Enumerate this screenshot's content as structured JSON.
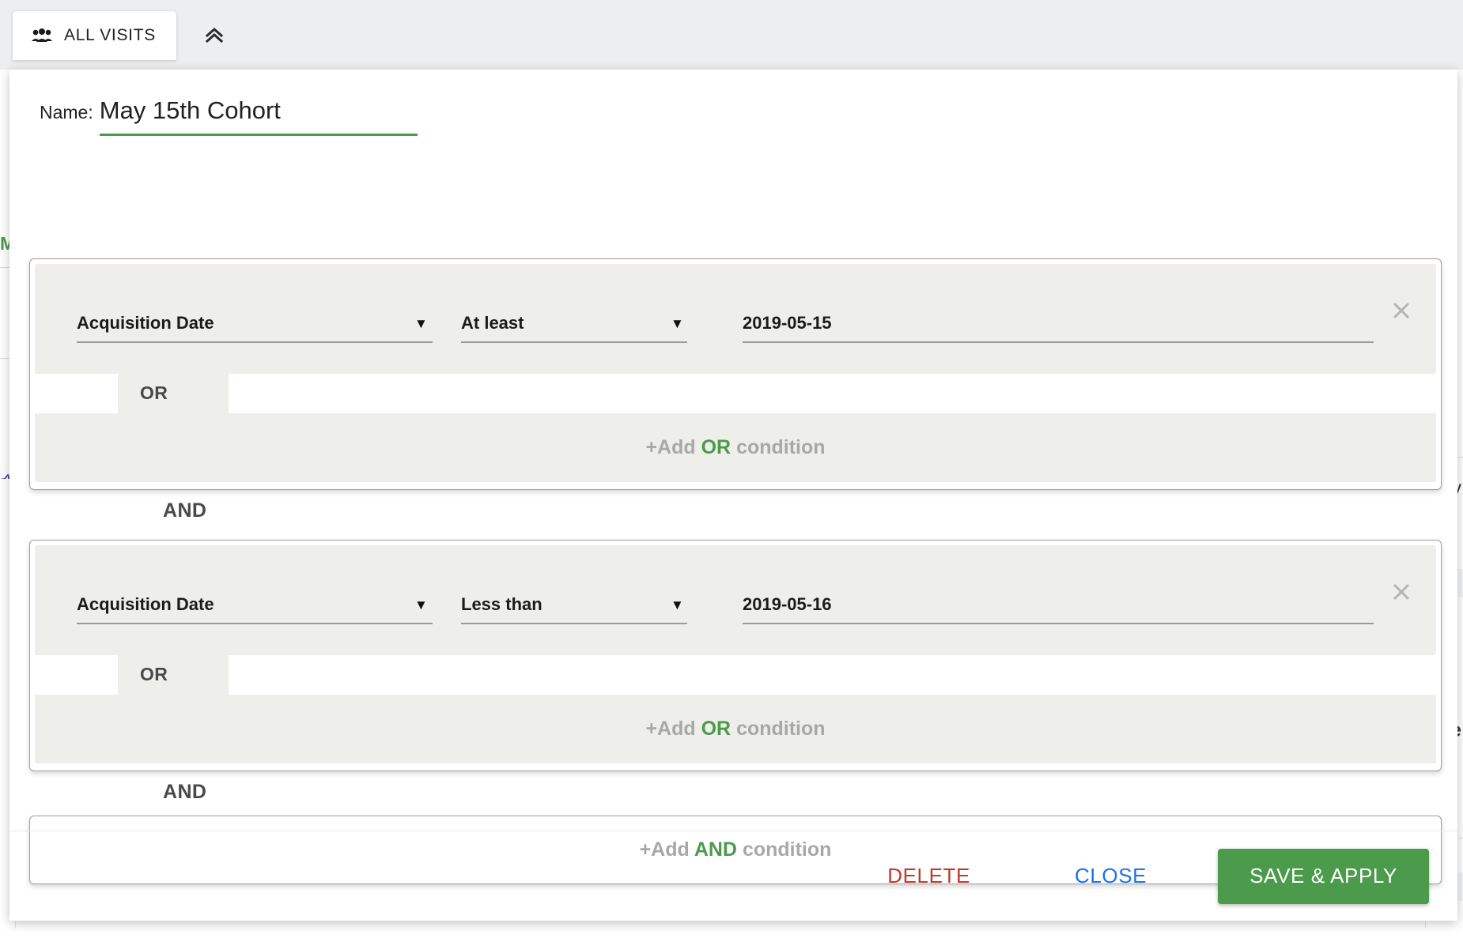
{
  "topbar": {
    "tab": {
      "label": "ALL VISITS",
      "icon": "people-group-icon"
    },
    "collapse": {
      "icon": "double-chevron-up-icon"
    }
  },
  "background": {
    "left_text": "M",
    "right_text_1": "ay",
    "right_text_2": "ie"
  },
  "modal": {
    "name": {
      "label": "Name:",
      "value": "May 15th Cohort",
      "placeholder": "Name"
    },
    "groups": [
      {
        "conditions": [
          {
            "attribute": "Acquisition Date",
            "operator": "At least",
            "value": "2019-05-15",
            "caret": "▼",
            "remove_icon": "close-icon"
          }
        ],
        "or_label": "OR",
        "add_or": {
          "prefix": "+Add",
          "keyword": "OR",
          "suffix": "condition"
        }
      },
      {
        "conditions": [
          {
            "attribute": "Acquisition Date",
            "operator": "Less than",
            "value": "2019-05-16",
            "caret": "▼",
            "remove_icon": "close-icon"
          }
        ],
        "or_label": "OR",
        "add_or": {
          "prefix": "+Add",
          "keyword": "OR",
          "suffix": "condition"
        }
      }
    ],
    "and_label": "AND",
    "add_and": {
      "prefix": "+Add",
      "keyword": "AND",
      "suffix": "condition"
    },
    "footer": {
      "delete_label": "DELETE",
      "close_label": "CLOSE",
      "save_label": "SAVE & APPLY"
    }
  },
  "colors": {
    "accent_green": "#4c9a4c",
    "delete_red": "#c0392b",
    "close_blue": "#1a73e8",
    "panel_gray": "#eeeeea",
    "border_brown": "#a79c96"
  }
}
